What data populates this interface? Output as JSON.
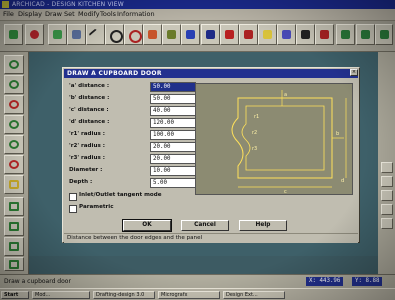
{
  "window": {
    "title": "ARCHICAD - DESIGN KITCHEN VIEW"
  },
  "menubar": [
    "File",
    "Display",
    "Draw",
    "Set",
    "Modify",
    "Tools",
    "Information"
  ],
  "dialog": {
    "title": "DRAW A CUPBOARD DOOR",
    "fields": [
      {
        "label": "'a' distance :",
        "value": "50.00"
      },
      {
        "label": "'b' distance :",
        "value": "50.00"
      },
      {
        "label": "'c' distance :",
        "value": "40.00"
      },
      {
        "label": "'d' distance :",
        "value": "120.00"
      },
      {
        "label": "'r1' radius :",
        "value": "100.00"
      },
      {
        "label": "'r2' radius :",
        "value": "20.00"
      },
      {
        "label": "'r3' radius :",
        "value": "20.00"
      },
      {
        "label": "Diameter :",
        "value": "10.00"
      },
      {
        "label": "Depth :",
        "value": "5.00"
      }
    ],
    "checkboxes": [
      {
        "label": "Inlet/Outlet tangent mode"
      },
      {
        "label": "Parametric"
      }
    ],
    "buttons": {
      "ok": "OK",
      "cancel": "Cancel",
      "help": "Help"
    },
    "hint": "Distance between the door edges and the panel",
    "preview_labels": {
      "a": "a",
      "b": "b",
      "c": "c",
      "d": "d",
      "r1": "r1",
      "r2": "r2",
      "r3": "r3"
    }
  },
  "status": {
    "message": "Draw a cupboard door",
    "x": "X: 443.96",
    "y": "Y: 8.88"
  },
  "taskbar": {
    "start": "Start",
    "items": [
      "Mod...",
      "Drafting-design 3.0",
      "Micrografx",
      "Design Ext..."
    ]
  },
  "colors": {
    "titlebar": "#1b2a8e",
    "canvas": "#3e6069",
    "dialog": "#c0bdb0",
    "preview_bg": "#8c8b72",
    "preview_line": "#ffe15a"
  }
}
